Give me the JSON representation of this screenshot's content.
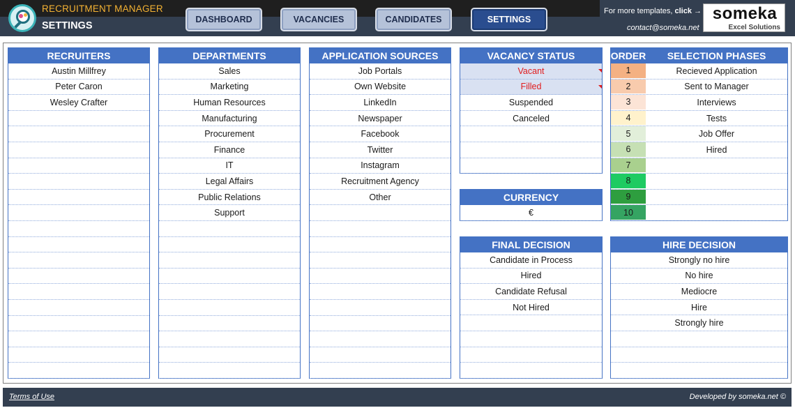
{
  "header": {
    "app_title": "RECRUITMENT MANAGER",
    "page_title": "SETTINGS",
    "nav": {
      "dashboard": "DASHBOARD",
      "vacancies": "VACANCIES",
      "candidates": "CANDIDATES",
      "settings": "SETTINGS"
    },
    "more_templates_prefix": "For more templates,",
    "more_templates_link": "click →",
    "contact": "contact@someka.net",
    "brand_name": "someka",
    "brand_sub": "Excel Solutions"
  },
  "recruiters": {
    "title": "RECRUITERS",
    "items": [
      "Austin Millfrey",
      "Peter Caron",
      "Wesley Crafter",
      "",
      "",
      "",
      "",
      "",
      "",
      "",
      "",
      "",
      "",
      "",
      "",
      "",
      "",
      "",
      "",
      ""
    ]
  },
  "departments": {
    "title": "DEPARTMENTS",
    "items": [
      "Sales",
      "Marketing",
      "Human Resources",
      "Manufacturing",
      "Procurement",
      "Finance",
      "IT",
      "Legal Affairs",
      "Public Relations",
      "Support",
      "",
      "",
      "",
      "",
      "",
      "",
      "",
      "",
      "",
      ""
    ]
  },
  "application_sources": {
    "title": "APPLICATION SOURCES",
    "items": [
      "Job Portals",
      "Own Website",
      "LinkedIn",
      "Newspaper",
      "Facebook",
      "Twitter",
      "Instagram",
      "Recruitment Agency",
      "Other",
      "",
      "",
      "",
      "",
      "",
      "",
      "",
      "",
      "",
      "",
      ""
    ]
  },
  "vacancy_status": {
    "title": "VACANCY STATUS",
    "items": [
      "Vacant",
      "Filled",
      "Suspended",
      "Canceled",
      "",
      "",
      ""
    ],
    "highlighted": [
      0,
      1
    ]
  },
  "currency": {
    "title": "CURRENCY",
    "value": "€"
  },
  "final_decision": {
    "title": "FINAL DECISION",
    "items": [
      "Candidate in Process",
      "Hired",
      "Candidate Refusal",
      "Not Hired",
      "",
      "",
      "",
      ""
    ]
  },
  "selection_phases": {
    "order_title": "ORDER",
    "phases_title": "SELECTION PHASES",
    "rows": [
      {
        "order": "1",
        "phase": "Recieved Application",
        "color": "#f4b183"
      },
      {
        "order": "2",
        "phase": "Sent to Manager",
        "color": "#f8cbad"
      },
      {
        "order": "3",
        "phase": "Interviews",
        "color": "#fce4d6"
      },
      {
        "order": "4",
        "phase": "Tests",
        "color": "#fff2cc"
      },
      {
        "order": "5",
        "phase": "Job Offer",
        "color": "#e2efda"
      },
      {
        "order": "6",
        "phase": "Hired",
        "color": "#c6e0b4"
      },
      {
        "order": "7",
        "phase": "",
        "color": "#a9d08e"
      },
      {
        "order": "8",
        "phase": "",
        "color": "#1ecb62"
      },
      {
        "order": "9",
        "phase": "",
        "color": "#2e9e3f"
      },
      {
        "order": "10",
        "phase": "",
        "color": "#35a462"
      }
    ]
  },
  "hire_decision": {
    "title": "HIRE DECISION",
    "items": [
      "Strongly no hire",
      "No hire",
      "Mediocre",
      "Hire",
      "Strongly hire",
      "",
      "",
      ""
    ]
  },
  "footer": {
    "terms": "Terms of Use",
    "developed": "Developed by someka.net ©"
  },
  "colors": {
    "header_bg": "#333f50",
    "panel_head": "#4472c4",
    "accent_orange": "#f4b233",
    "active_nav": "#2a4d8f"
  }
}
